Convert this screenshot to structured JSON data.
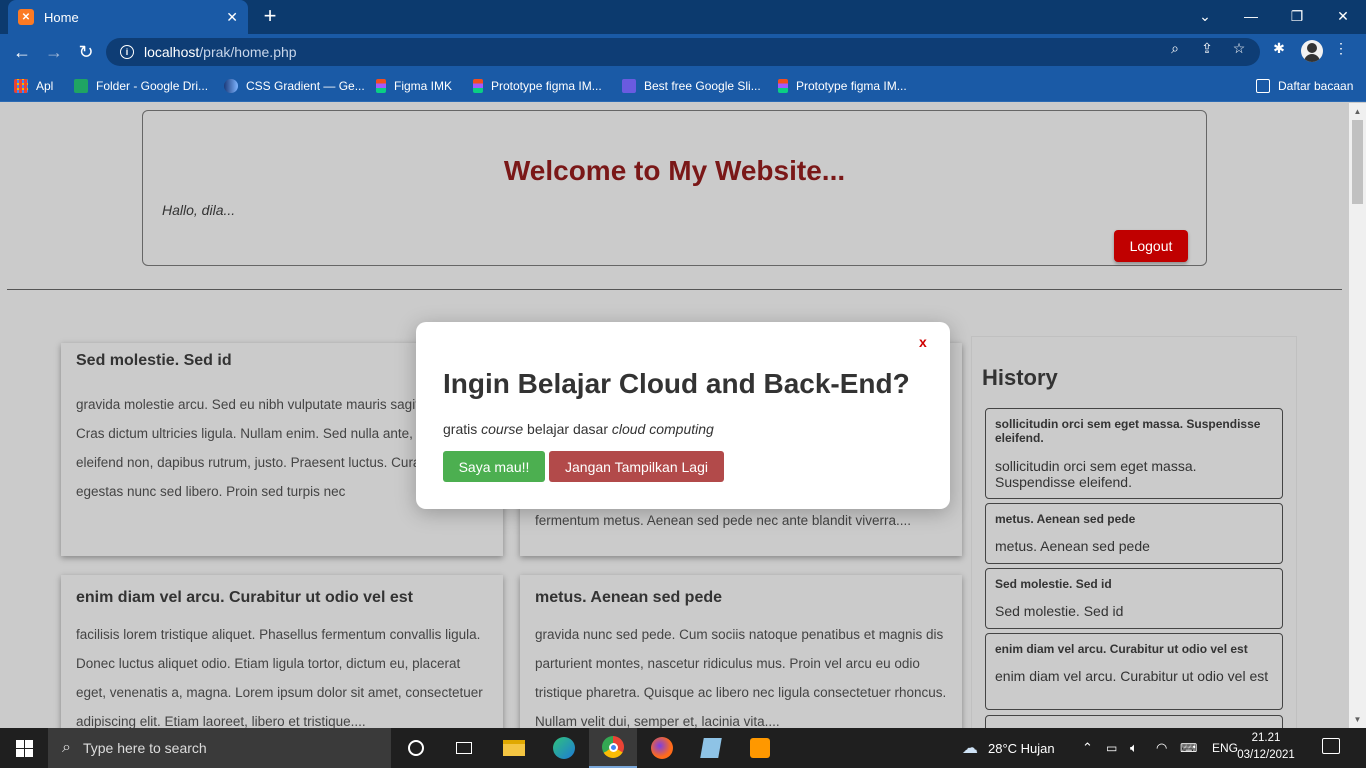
{
  "browser": {
    "tab_title": "Home",
    "tab_close": "✕",
    "new_tab": "+",
    "url_host": "localhost",
    "url_path": "/prak/home.php",
    "bookmarks": [
      {
        "label": "Apl",
        "color": "#f4b400"
      },
      {
        "label": "Folder - Google Dri...",
        "color": "#1fa463"
      },
      {
        "label": "CSS Gradient — Ge...",
        "color": "#3b6fd4"
      },
      {
        "label": "Figma IMK",
        "color": "#f24e1e"
      },
      {
        "label": "Prototype figma IM...",
        "color": "#f24e1e"
      },
      {
        "label": "Best free Google Sli...",
        "color": "#6a5be0"
      },
      {
        "label": "Prototype figma IM...",
        "color": "#f24e1e"
      }
    ],
    "reading_list": "Daftar bacaan"
  },
  "header": {
    "welcome": "Welcome to My Website...",
    "greeting": "Hallo, dila...",
    "logout": "Logout"
  },
  "posts": [
    {
      "title": "Sed molestie. Sed id",
      "body": "gravida molestie arcu. Sed eu nibh vulputate mauris sagittis placerat. Cras dictum ultricies ligula. Nullam enim. Sed nulla ante, iaculis nec, eleifend non, dapibus rutrum, justo. Praesent luctus. Curabitur egestas nunc sed libero. Proin sed turpis nec"
    },
    {
      "title": "",
      "body": "fermentum metus. Aenean sed pede nec ante blandit viverra...."
    },
    {
      "title": "enim diam vel arcu. Curabitur ut odio vel est",
      "body": "facilisis lorem tristique aliquet. Phasellus fermentum convallis ligula. Donec luctus aliquet odio. Etiam ligula tortor, dictum eu, placerat eget, venenatis a, magna. Lorem ipsum dolor sit amet, consectetuer adipiscing elit. Etiam laoreet, libero et tristique...."
    },
    {
      "title": "metus. Aenean sed pede",
      "body": "gravida nunc sed pede. Cum sociis natoque penatibus et magnis dis parturient montes, nascetur ridiculus mus. Proin vel arcu eu odio tristique pharetra. Quisque ac libero nec ligula consectetuer rhoncus. Nullam velit dui, semper et, lacinia vita...."
    }
  ],
  "history": {
    "title": "History",
    "items": [
      {
        "head": "sollicitudin orci sem eget massa. Suspendisse eleifend.",
        "text": "sollicitudin orci sem eget massa. Suspendisse eleifend."
      },
      {
        "head": "metus. Aenean sed pede",
        "text": "metus. Aenean sed pede"
      },
      {
        "head": "Sed molestie. Sed id",
        "text": "Sed molestie. Sed id"
      },
      {
        "head": "enim diam vel arcu. Curabitur ut odio vel est",
        "text": "enim diam vel arcu. Curabitur ut odio vel est"
      }
    ]
  },
  "modal": {
    "close": "x",
    "title": "Ingin Belajar Cloud and Back-End?",
    "text_1": "gratis ",
    "text_2": "course",
    "text_3": " belajar dasar ",
    "text_4": "cloud computing",
    "yes_label": "Saya mau!!",
    "no_label": "Jangan Tampilkan Lagi"
  },
  "taskbar": {
    "search_placeholder": "Type here to search",
    "weather": "28°C  Hujan",
    "language": "ENG",
    "time": "21.21",
    "date": "03/12/2021"
  }
}
